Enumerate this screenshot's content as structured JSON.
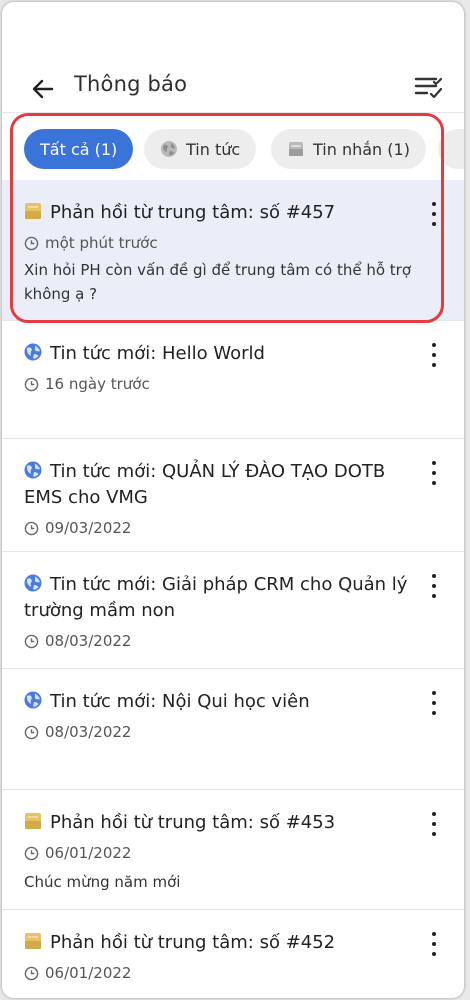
{
  "header": {
    "title": "Thông báo",
    "back_icon": "arrow-left-icon",
    "menu_icon": "checklist-icon"
  },
  "tabs": [
    {
      "label": "Tất cả (1)",
      "active": true,
      "icon": ""
    },
    {
      "label": "Tin tức",
      "active": false,
      "icon": "globe-icon"
    },
    {
      "label": "Tin nhắn (1)",
      "active": false,
      "icon": "envelope-icon"
    }
  ],
  "notifications": [
    {
      "icon": "envelope-icon",
      "title": "Phản hồi từ trung tâm: số #457",
      "time": "một phút trước",
      "message": "Xin hỏi PH còn vấn đề gì để trung tâm có thể hỗ trợ không ạ ?",
      "highlighted": true
    },
    {
      "icon": "globe-icon",
      "title": "Tin tức mới: Hello World",
      "time": "16 ngày trước",
      "message": ""
    },
    {
      "icon": "globe-icon",
      "title": "Tin tức mới: QUẢN LÝ ĐÀO TẠO DOTB EMS cho VMG",
      "time": "09/03/2022",
      "message": ""
    },
    {
      "icon": "globe-icon",
      "title": "Tin tức mới: Giải pháp CRM cho Quản lý trường mầm non",
      "time": "08/03/2022",
      "message": ""
    },
    {
      "icon": "globe-icon",
      "title": "Tin tức mới: Nội Qui học viên",
      "time": "08/03/2022",
      "message": ""
    },
    {
      "icon": "envelope-icon",
      "title": "Phản hồi từ trung tâm: số #453",
      "time": "06/01/2022",
      "message": "Chúc mừng năm mới"
    },
    {
      "icon": "envelope-icon",
      "title": "Phản hồi từ trung tâm: số #452",
      "time": "06/01/2022",
      "message": ""
    }
  ],
  "colors": {
    "accent": "#3b74d8",
    "highlight": "#e9eef9",
    "annotation": "#e53a3f",
    "envelope": "#e7c266",
    "globe": "#4a7be0"
  }
}
